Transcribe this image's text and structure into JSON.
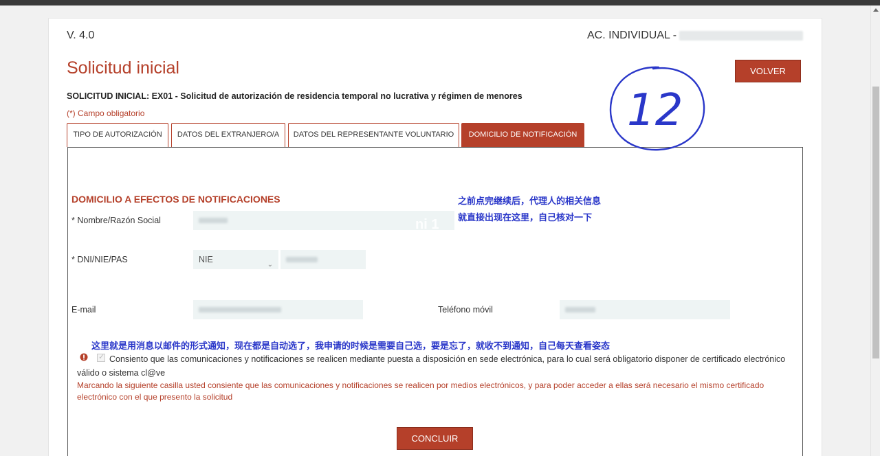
{
  "header": {
    "version": "V. 4.0",
    "ac_individual": "AC. INDIVIDUAL -"
  },
  "page": {
    "title": "Solicitud inicial",
    "back_label": "VOLVER",
    "subtitle": "SOLICITUD INICIAL: EX01 - Solicitud de autorización de residencia temporal no lucrativa y régimen de menores",
    "required_note": "(*) Campo obligatorio"
  },
  "tabs": [
    {
      "label": "TIPO DE AUTORIZACIÓN",
      "active": false
    },
    {
      "label": "DATOS DEL EXTRANJERO/A",
      "active": false
    },
    {
      "label": "DATOS DEL REPRESENTANTE VOLUNTARIO",
      "active": false
    },
    {
      "label": "DOMICILIO DE NOTIFICACIÓN",
      "active": true
    }
  ],
  "form": {
    "section_title": "DOMICILIO A EFECTOS DE NOTIFICACIONES",
    "name_label": "* Nombre/Razón Social",
    "doc_label": "* DNI/NIE/PAS",
    "doc_type_value": "NIE",
    "email_label": "E-mail",
    "phone_label": "Teléfono móvil",
    "consent_text": "Consiento que las comunicaciones y notificaciones se realicen mediante puesta a disposición en sede electrónica, para lo cual será obligatorio disponer de certificado electrónico válido o sistema cl@ve",
    "consent_checked": true,
    "notice_text": "Marcando la siguiente casilla usted consiente que las comunicaciones y notificaciones se realicen por medios electrónicos, y para poder acceder a ellas será necesario el mismo certificado electrónico con el que presento la solicitud",
    "submit_label": "CONCLUIR"
  },
  "annotations": {
    "circle_number": "12",
    "right_note": "之前点完继续后，代理人的相关信息就直接出现在这里，自己核对一下",
    "bottom_note": "这里就是用消息以邮件的形式通知，现在都是自动选了，我申请的时候是需要自己选，要是忘了，就收不到通知，自己每天查看姿态"
  },
  "colors": {
    "brand": "#b5402a",
    "annotation_blue": "#2a37c9",
    "field_bg": "#eef4f4"
  }
}
